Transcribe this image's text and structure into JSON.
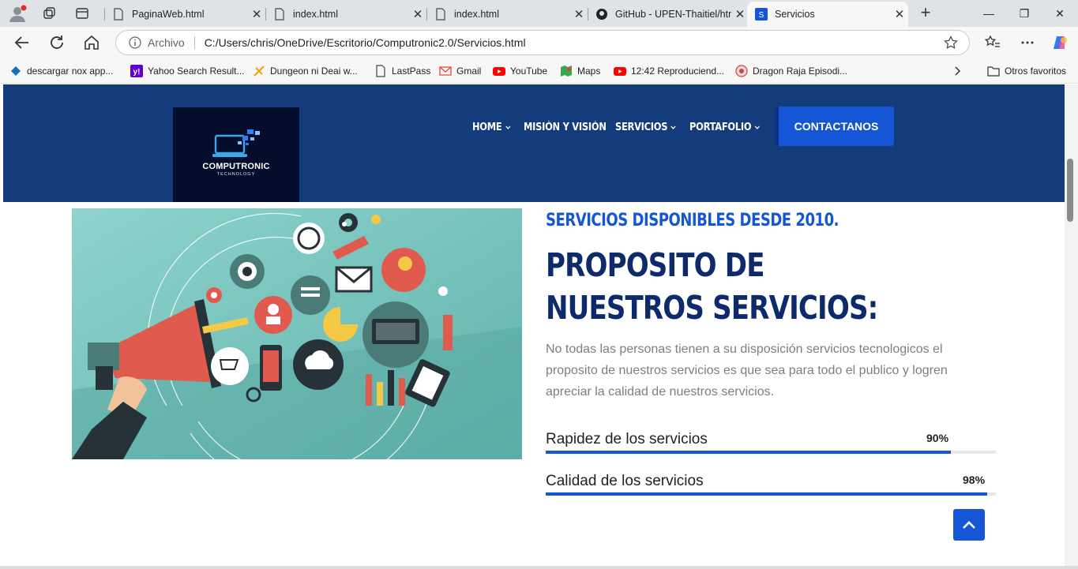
{
  "browser": {
    "tabs": [
      {
        "title": "PaginaWeb.html",
        "active": false
      },
      {
        "title": "index.html",
        "active": false
      },
      {
        "title": "index.html",
        "active": false
      },
      {
        "title": "GitHub - UPEN-Thaitiel/htm",
        "active": false
      },
      {
        "title": "Servicios",
        "active": true
      }
    ],
    "address": {
      "site_label": "Archivo",
      "url": "C:/Users/chris/OneDrive/Escritorio/Computronic2.0/Servicios.html"
    },
    "bookmarks": [
      {
        "label": "descargar nox app...",
        "icon": "nox-icon"
      },
      {
        "label": "Yahoo Search Result...",
        "icon": "yahoo-icon"
      },
      {
        "label": "Dungeon ni Deai w...",
        "icon": "dungeon-icon"
      },
      {
        "label": "LastPass",
        "icon": "page-icon"
      },
      {
        "label": "Gmail",
        "icon": "gmail-icon"
      },
      {
        "label": "YouTube",
        "icon": "youtube-icon"
      },
      {
        "label": "Maps",
        "icon": "maps-icon"
      },
      {
        "label": "12:42 Reproduciend...",
        "icon": "youtube-icon"
      },
      {
        "label": "Dragon Raja Episodi...",
        "icon": "dragon-icon"
      }
    ],
    "other_bookmarks": "Otros favoritos",
    "colors": {
      "tabstrip": "#dfe3e8",
      "toolbar": "#f7f7f7"
    }
  },
  "site": {
    "logo": {
      "brand": "COMPUTRONIC",
      "tagline": "TECHNOLOGY"
    },
    "nav": [
      {
        "label": "HOME",
        "dropdown": true
      },
      {
        "label": "MISIÓN Y VISIÓN",
        "dropdown": false
      },
      {
        "label": "SERVICIOS",
        "dropdown": true
      },
      {
        "label": "PORTAFOLIO",
        "dropdown": true
      }
    ],
    "cta": "CONTACTANOS",
    "colors": {
      "header": "#143c7d",
      "accent": "#1456d6",
      "title": "#0d2a6b"
    }
  },
  "content": {
    "eyebrow": "SERVICIOS DISPONIBLES DESDE 2010.",
    "title": "PROPOSITO DE NUESTROS SERVICIOS:",
    "description": "No todas las personas tienen a su disposición servicios tecnologicos el proposito de nuestros servicios es que sea para todo el publico y logren apreciar la calidad de nuestros servicios.",
    "skills": [
      {
        "label": "Rapidez de los servicios",
        "percent_label": "90%",
        "value": 0.9
      },
      {
        "label": "Calidad de los servicios",
        "percent_label": "98%",
        "value": 0.98
      }
    ],
    "hero_image": "digital-marketing-megaphone-illustration"
  }
}
